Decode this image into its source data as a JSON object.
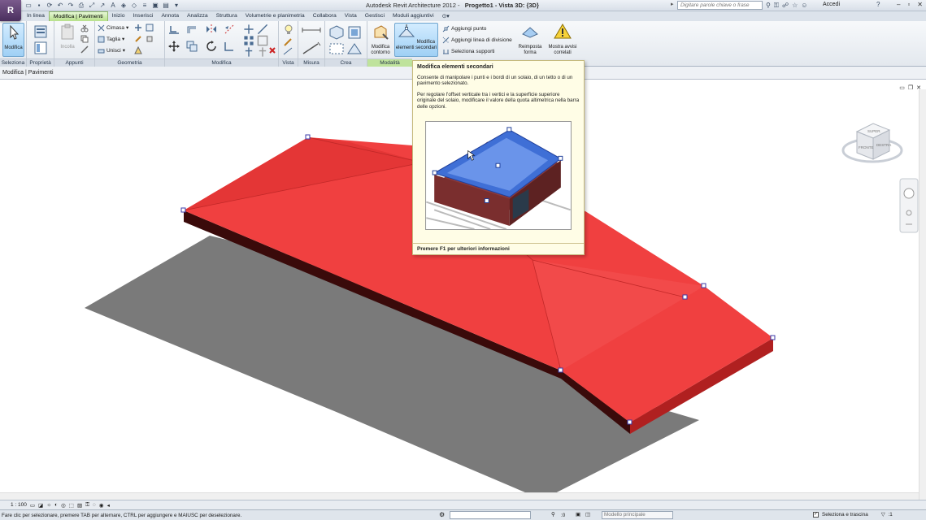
{
  "window": {
    "app_title": "Autodesk Revit Architecture 2012 -",
    "doc_title": "Progetto1 - Vista 3D: {3D}",
    "search_placeholder": "Digitare parole chiave o frase",
    "account_label": "Accedi",
    "help_label": "?"
  },
  "tabs": [
    {
      "label": "In linea"
    },
    {
      "label": "Modifica | Pavimenti"
    },
    {
      "label": "Inizio"
    },
    {
      "label": "Inserisci"
    },
    {
      "label": "Annota"
    },
    {
      "label": "Analizza"
    },
    {
      "label": "Struttura"
    },
    {
      "label": "Volumetrie e planimetria"
    },
    {
      "label": "Collabora"
    },
    {
      "label": "Vista"
    },
    {
      "label": "Gestisci"
    },
    {
      "label": "Moduli aggiuntivi"
    }
  ],
  "ribbon": {
    "panels": {
      "seleziona": "Seleziona",
      "proprieta": "Proprietà",
      "appunti": "Appunti",
      "geometria": "Geometria",
      "modifica": "Modifica",
      "vista": "Vista",
      "misura": "Misura",
      "crea": "Crea",
      "modalita": "Modalità"
    },
    "buttons": {
      "modifica": "Modifica",
      "incolla": "Incolla",
      "cimasa": "Cimasa",
      "taglia": "Taglia",
      "unisci": "Unisci",
      "modifica_contorno_1": "Modifica",
      "modifica_contorno_2": "contorno",
      "modifica_elementi_1": "Modifica",
      "modifica_elementi_2": "elementi secondari",
      "aggiungi_punto": "Aggiungi punto",
      "aggiungi_linea": "Aggiungi linea di divisione",
      "seleziona_supporti": "Seleziona supporti",
      "reimposta_1": "Reimposta",
      "reimposta_2": "forma",
      "mostra_avvisi_1": "Mostra avvisi",
      "mostra_avvisi_2": "correlati"
    }
  },
  "options_bar": {
    "label": "Modifica | Pavimenti"
  },
  "tooltip": {
    "title": "Modifica elementi secondari",
    "para1": "Consente di manipolare i punti e i bordi di un solaio, di un tetto o di un pavimento selezionato.",
    "para2": "Per regolare l'offset verticale tra i vertici e la superficie superiore originale del solaio, modificare il valore della quota altimetrica nella barra delle opzioni.",
    "footer": "Premere F1 per ulteriori informazioni"
  },
  "viewcube": {
    "top_face": "SUPER.",
    "front_face": "FRONTE",
    "right_face": "DESTRA"
  },
  "view_bar": {
    "scale": "1 : 100"
  },
  "status_bar": {
    "hint": "Fare clic per selezionare, premere TAB per alternare, CTRL per aggiungere e MAIUSC per deselezionare.",
    "count": ":0",
    "model": "Modello principale",
    "select_drag": "Seleziona e trascina",
    "filter_count": ":1"
  },
  "colors": {
    "slab_top": "#f04040",
    "slab_side": "#3a0a0a",
    "shadow": "#7a7a7a",
    "tab_context": "#bfe39c"
  }
}
